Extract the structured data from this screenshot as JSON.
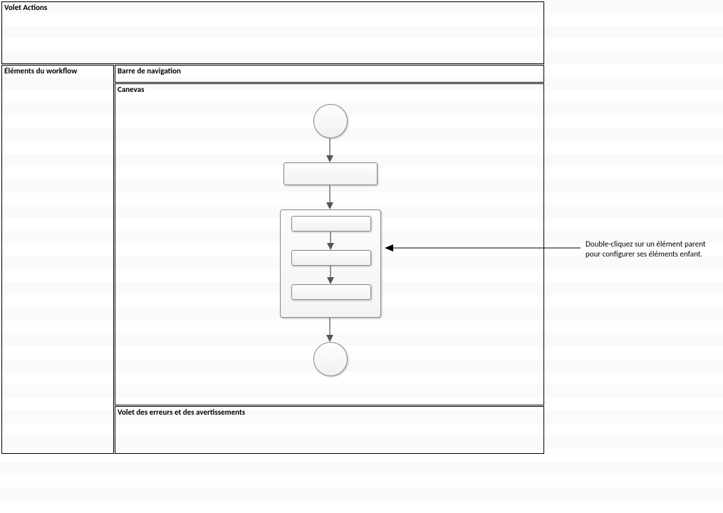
{
  "panes": {
    "actions": {
      "label": "Volet Actions"
    },
    "elements": {
      "label": "Éléments du workflow"
    },
    "navbar": {
      "label": "Barre de navigation"
    },
    "canvas": {
      "label": "Canevas"
    },
    "errors": {
      "label": "Volet des erreurs et des avertissements"
    }
  },
  "callout": {
    "line1": "Double-cliquez sur un élément parent",
    "line2": "pour configurer ses éléments enfant."
  }
}
